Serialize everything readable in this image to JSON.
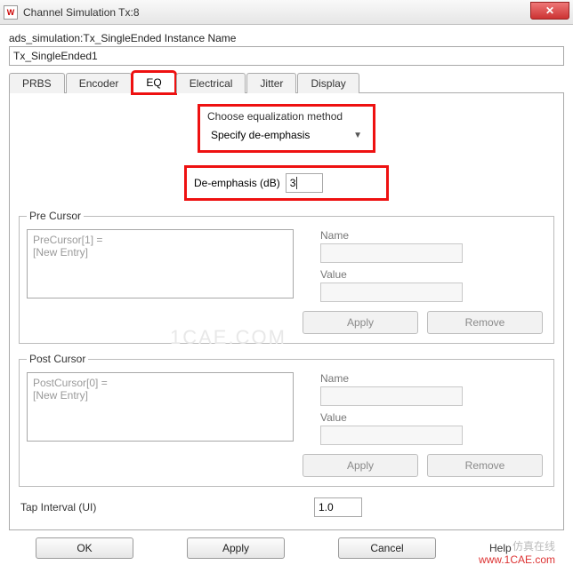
{
  "titlebar": {
    "title": "Channel Simulation Tx:8",
    "icon_glyph": "W"
  },
  "instance": {
    "label": "ads_simulation:Tx_SingleEnded Instance Name",
    "value": "Tx_SingleEnded1"
  },
  "tabs": [
    "PRBS",
    "Encoder",
    "EQ",
    "Electrical",
    "Jitter",
    "Display"
  ],
  "active_tab": "EQ",
  "eq": {
    "choose_label": "Choose equalization method",
    "choose_value": "Specify de-emphasis",
    "deemph_label": "De-emphasis (dB)",
    "deemph_value": "3"
  },
  "pre": {
    "legend": "Pre Cursor",
    "list_line1": "PreCursor[1] =",
    "list_line2": "[New Entry]",
    "name_label": "Name",
    "value_label": "Value",
    "apply": "Apply",
    "remove": "Remove"
  },
  "post": {
    "legend": "Post Cursor",
    "list_line1": "PostCursor[0] =",
    "list_line2": "[New Entry]",
    "name_label": "Name",
    "value_label": "Value",
    "apply": "Apply",
    "remove": "Remove"
  },
  "tap": {
    "label": "Tap Interval (UI)",
    "value": "1.0"
  },
  "buttons": {
    "ok": "OK",
    "apply": "Apply",
    "cancel": "Cancel",
    "help": "Help"
  },
  "watermark": "1CAE.COM",
  "footer_wm1": "仿真在线",
  "footer_wm2": "www.1CAE.com"
}
